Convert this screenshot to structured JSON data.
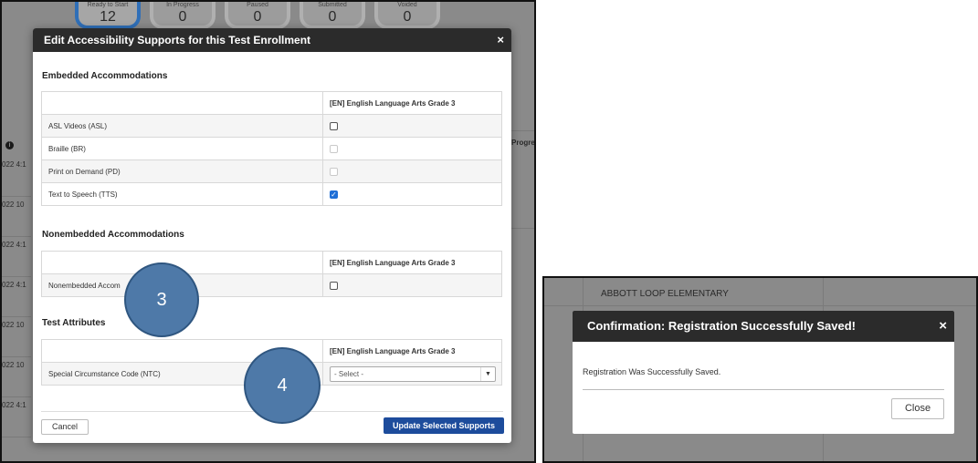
{
  "left": {
    "background_stats": [
      {
        "label": "Ready to Start",
        "value": "12"
      },
      {
        "label": "In Progress",
        "value": "0"
      },
      {
        "label": "Paused",
        "value": "0"
      },
      {
        "label": "Submitted",
        "value": "0"
      },
      {
        "label": "Voided",
        "value": "0"
      }
    ],
    "background_left_dates": [
      "022 4:1",
      "022 10",
      "022 4:1",
      "022 4:1",
      "022 10",
      "022 10",
      "022 4:1"
    ],
    "background_right_header": "Progress",
    "modal": {
      "title": "Edit Accessibility Supports for this Test Enrollment",
      "close_glyph": "×",
      "embedded": {
        "title": "Embedded Accommodations",
        "column_header": "[EN] English Language Arts Grade 3",
        "rows": [
          {
            "label": "ASL Videos (ASL)",
            "state": "unchecked"
          },
          {
            "label": "Braille (BR)",
            "state": "disabled"
          },
          {
            "label": "Print on Demand (PD)",
            "state": "disabled"
          },
          {
            "label": "Text to Speech (TTS)",
            "state": "checked"
          }
        ]
      },
      "nonembedded": {
        "title": "Nonembedded Accommodations",
        "column_header": "[EN] English Language Arts Grade 3",
        "rows": [
          {
            "label": "Nonembedded Accom",
            "state": "unchecked"
          }
        ]
      },
      "attributes": {
        "title": "Test Attributes",
        "column_header": "[EN] English Language Arts Grade 3",
        "rows": [
          {
            "label": "Special Circumstance Code (NTC)",
            "select_value": "- Select -"
          }
        ]
      },
      "cancel_label": "Cancel",
      "update_label": "Update Selected Supports"
    },
    "callouts": [
      "3",
      "4"
    ]
  },
  "right": {
    "background_top_text": "ABBOTT LOOP ELEMENTARY",
    "background_bottom_text": "ABBOTT LOOP ELEMENTARY",
    "dialog": {
      "title": "Confirmation: Registration Successfully Saved!",
      "close_glyph": "×",
      "message": "Registration Was Successfully Saved.",
      "close_label": "Close"
    }
  },
  "colors": {
    "modal_header": "#2b2b2b",
    "primary_button": "#1d4c9c",
    "checkbox_checked": "#1f6fd6",
    "callout": "#4e79a8",
    "overlay": "#8a8a8a"
  }
}
